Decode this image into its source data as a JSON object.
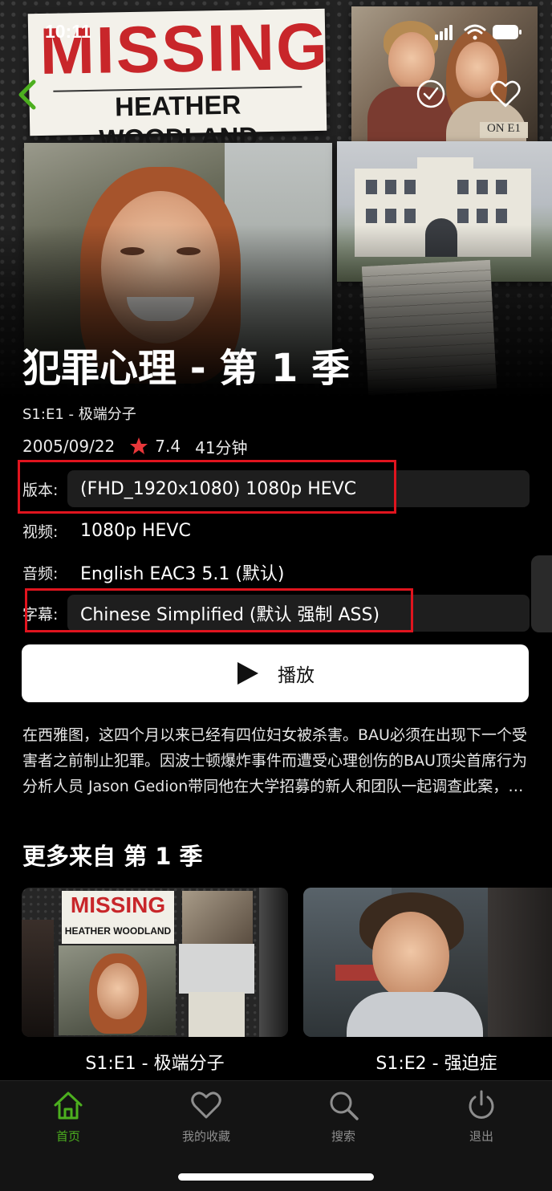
{
  "status_bar": {
    "time": "10:11"
  },
  "hero": {
    "poster_word": "MISSING",
    "poster_name": "HEATHER WOODLAND",
    "photo_stamp": "ON E1"
  },
  "show": {
    "title": "犯罪心理 - 第 1 季",
    "episode_code": "S1:E1 - 极端分子",
    "air_date": "2005/09/22",
    "rating": "7.4",
    "duration": "41分钟"
  },
  "options": {
    "version": {
      "label": "版本:",
      "value": "(FHD_1920x1080) 1080p HEVC"
    },
    "video": {
      "label": "视频:",
      "value": "1080p HEVC"
    },
    "audio": {
      "label": "音频:",
      "value": "English EAC3 5.1 (默认)"
    },
    "subtitle": {
      "label": "字幕:",
      "value": "Chinese Simplified (默认 强制 ASS)"
    }
  },
  "play": {
    "label": "播放"
  },
  "overview": "在西雅图，这四个月以来已经有四位妇女被杀害。BAU必须在出现下一个受害者之前制止犯罪。因波士顿爆炸事件而遭受心理创伤的BAU顶尖首席行为分析人员 Jason Gedion带同他在大学招募的新人和团队一起调查此案，并很快锁定了嫌疑人。",
  "more_section": {
    "title": "更多来自 第 1 季",
    "episodes": [
      {
        "label": "S1:E1 - 极端分子",
        "thumb_word": "MISSING",
        "thumb_name": "HEATHER WOODLAND"
      },
      {
        "label": "S1:E2 - 强迫症"
      }
    ]
  },
  "tabbar": {
    "tabs": [
      {
        "label": "首页",
        "icon": "home-icon",
        "active": true
      },
      {
        "label": "我的收藏",
        "icon": "heart-icon",
        "active": false
      },
      {
        "label": "搜索",
        "icon": "search-icon",
        "active": false
      },
      {
        "label": "退出",
        "icon": "power-icon",
        "active": false
      }
    ]
  },
  "colors": {
    "accent_green": "#4caf1f",
    "highlight_red": "#e0141e",
    "star_red": "#e8373a"
  }
}
